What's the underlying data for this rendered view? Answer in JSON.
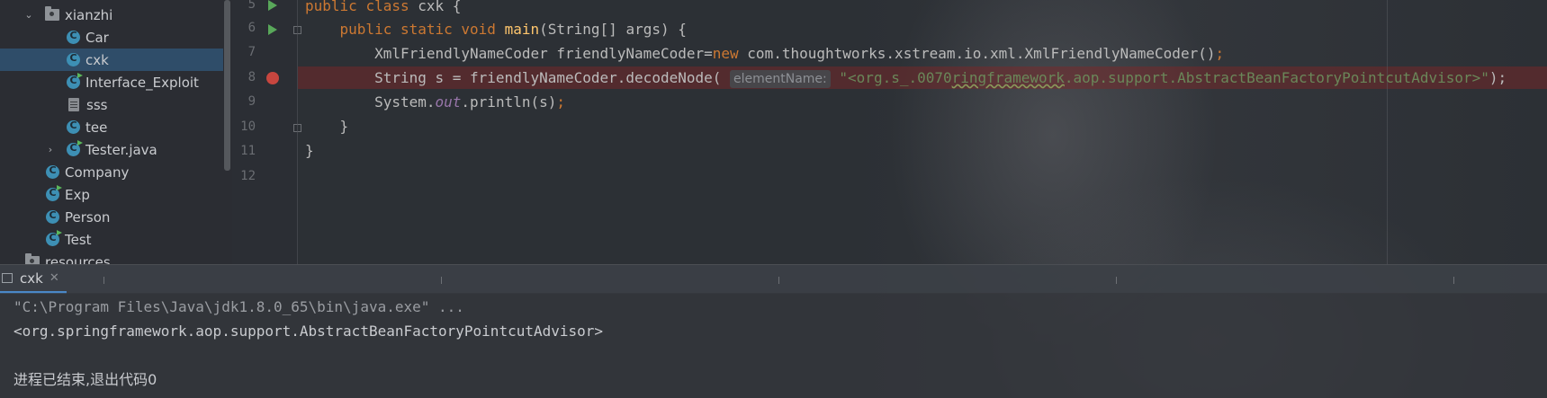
{
  "project_tree": {
    "items": [
      {
        "label": "xianzhi",
        "kind": "folder",
        "expanded": true
      },
      {
        "label": "Car",
        "kind": "class"
      },
      {
        "label": "cxk",
        "kind": "class",
        "selected": true
      },
      {
        "label": "Interface_Exploit",
        "kind": "class-exec"
      },
      {
        "label": "sss",
        "kind": "file"
      },
      {
        "label": "tee",
        "kind": "class"
      },
      {
        "label": "Tester.java",
        "kind": "class-exec",
        "collapsed": true
      },
      {
        "label": "Company",
        "kind": "class"
      },
      {
        "label": "Exp",
        "kind": "class-exec"
      },
      {
        "label": "Person",
        "kind": "class"
      },
      {
        "label": "Test",
        "kind": "class-exec"
      },
      {
        "label": "resources",
        "kind": "folder"
      }
    ]
  },
  "editor": {
    "line_numbers": [
      "5",
      "6",
      "7",
      "8",
      "9",
      "10",
      "11",
      "12"
    ],
    "lines": {
      "l5": {
        "kw1": "public",
        "kw2": "class",
        "rest": "cxk {"
      },
      "l6": {
        "kw1": "public",
        "kw2": "static",
        "kw3": "void",
        "fn": "main",
        "rest": "(String[] args) {"
      },
      "l7": {
        "a": "XmlFriendlyNameCoder friendlyNameCoder=",
        "kw": "new",
        "b": "com.thoughtworks.xstream.io.xml.XmlFriendlyNameCoder()",
        "semi": ";"
      },
      "l8": {
        "a": "String s = friendlyNameCoder.decodeNode(",
        "hint": "elementName:",
        "str1": "\"<org.s_.0070",
        "str_squig": "ringframework",
        "str2": ".aop.support.AbstractBeanFactoryPointcutAdvisor>\"",
        "close": ");"
      },
      "l9": {
        "a": "System.",
        "field": "out",
        "b": ".println(s)",
        "semi": ";"
      },
      "l10": "}",
      "l11": "}"
    }
  },
  "run_panel": {
    "tab_label": "cxk",
    "console": {
      "cmd": "\"C:\\Program Files\\Java\\jdk1.8.0_65\\bin\\java.exe\" ...",
      "output": "<org.springframework.aop.support.AbstractBeanFactoryPointcutAdvisor>",
      "exit": "进程已结束,退出代码0"
    }
  },
  "colors": {
    "keyword": "#cc7832",
    "function": "#ffc66d",
    "string": "#6a8759",
    "field": "#9876aa",
    "selection": "#2f4d69",
    "breakpoint": "#c7463f",
    "run_icon": "#59a85a"
  }
}
